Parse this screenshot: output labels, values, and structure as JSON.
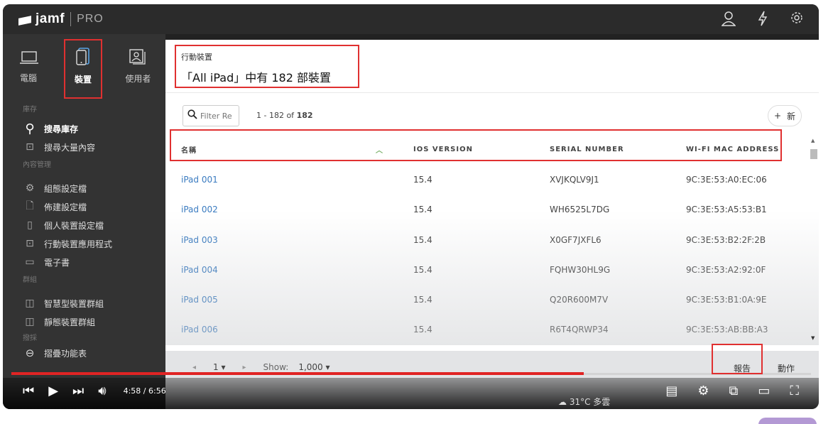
{
  "app": {
    "brand": "jamf",
    "edition": "PRO"
  },
  "topbar": {
    "user_icon": "user-icon",
    "bolt_icon": "bolt-icon",
    "gear_icon": "gear-icon"
  },
  "sidebar": {
    "tabs": [
      {
        "label": "電腦",
        "icon": "laptop-icon"
      },
      {
        "label": "裝置",
        "icon": "mobile-device-icon"
      },
      {
        "label": "使用者",
        "icon": "users-icon"
      }
    ],
    "sections": {
      "inventory": "庫存",
      "content": "內容管理",
      "groups": "群組",
      "enroll": "撥採"
    },
    "inventory_items": [
      "搜尋庫存",
      "搜尋大量內容"
    ],
    "content_items": [
      "組態設定檔",
      "佈建設定檔",
      "個人裝置設定檔",
      "行動裝置應用程式",
      "電子書"
    ],
    "group_items": [
      "智慧型裝置群組",
      "靜態裝置群組"
    ],
    "collapse_label": "摺疊功能表"
  },
  "header": {
    "subtitle": "行動裝置",
    "title": "「All iPad」中有 182 部裝置"
  },
  "toolbar": {
    "filter_placeholder": "Filter Re",
    "count_text": "1 - 182 of ",
    "count_total": "182",
    "new_label": "新",
    "new_plus": "+"
  },
  "table": {
    "columns": [
      "名稱",
      "IOS VERSION",
      "SERIAL NUMBER",
      "WI-FI MAC ADDRESS"
    ],
    "rows": [
      [
        "iPad 001",
        "15.4",
        "XVJKQLV9J1",
        "9C:3E:53:A0:EC:06"
      ],
      [
        "iPad 002",
        "15.4",
        "WH6525L7DG",
        "9C:3E:53:A5:53:B1"
      ],
      [
        "iPad 003",
        "15.4",
        "X0GF7JXFL6",
        "9C:3E:53:B2:2F:2B"
      ],
      [
        "iPad 004",
        "15.4",
        "FQHW30HL9G",
        "9C:3E:53:A2:92:0F"
      ],
      [
        "iPad 005",
        "15.4",
        "Q20R600M7V",
        "9C:3E:53:B1:0A:9E"
      ],
      [
        "iPad 006",
        "15.4",
        "R6T4QRWP34",
        "9C:3E:53:AB:BB:A3"
      ]
    ]
  },
  "footer": {
    "page": "1",
    "show_label": "Show:",
    "show_value": "1,000",
    "report_label": "報告",
    "action_label": "動作"
  },
  "video": {
    "time": "4:58 / 6:56",
    "progress": 0.716,
    "weather": "31°C 多雲"
  },
  "colors": {
    "accent": "#3a7bc0",
    "highlight": "#e03030",
    "sidebar": "#333333",
    "progress": "#e02424"
  }
}
